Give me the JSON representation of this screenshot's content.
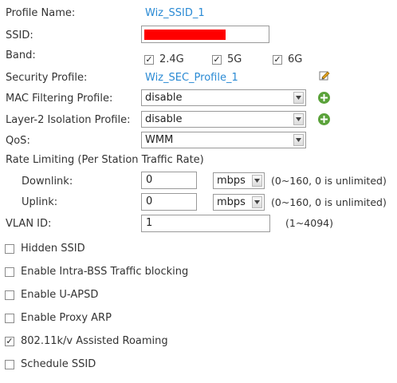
{
  "profile_name": {
    "label": "Profile Name:",
    "value": "Wiz_SSID_1"
  },
  "ssid": {
    "label": "SSID:",
    "value": "",
    "redacted_color": "#ff0000"
  },
  "band": {
    "label": "Band:",
    "options": [
      {
        "label": "2.4G",
        "checked": true
      },
      {
        "label": "5G",
        "checked": true
      },
      {
        "label": "6G",
        "checked": true
      }
    ]
  },
  "security_profile": {
    "label": "Security Profile:",
    "value": "Wiz_SEC_Profile_1",
    "icon": "edit-icon"
  },
  "mac_filtering": {
    "label": "MAC Filtering Profile:",
    "value": "disable",
    "icon": "add-icon"
  },
  "l2_isolation": {
    "label": "Layer-2 Isolation Profile:",
    "value": "disable",
    "icon": "add-icon"
  },
  "qos": {
    "label": "QoS:",
    "value": "WMM"
  },
  "rate_limiting": {
    "label": "Rate Limiting (Per Station Traffic Rate)",
    "downlink": {
      "label": "Downlink:",
      "value": "0",
      "unit": "mbps",
      "hint": "(0~160, 0 is unlimited)"
    },
    "uplink": {
      "label": "Uplink:",
      "value": "0",
      "unit": "mbps",
      "hint": "(0~160, 0 is unlimited)"
    }
  },
  "vlan": {
    "label": "VLAN ID:",
    "value": "1",
    "hint": "(1~4094)"
  },
  "options": [
    {
      "label": "Hidden SSID",
      "checked": false
    },
    {
      "label": "Enable Intra-BSS Traffic blocking",
      "checked": false
    },
    {
      "label": "Enable U-APSD",
      "checked": false
    },
    {
      "label": "Enable Proxy ARP",
      "checked": false
    },
    {
      "label": "802.11k/v Assisted Roaming",
      "checked": true
    },
    {
      "label": "Schedule SSID",
      "checked": false
    }
  ],
  "colors": {
    "link": "#2a8ad4",
    "add_icon": "#5aa23a",
    "redaction": "#ff0000"
  }
}
